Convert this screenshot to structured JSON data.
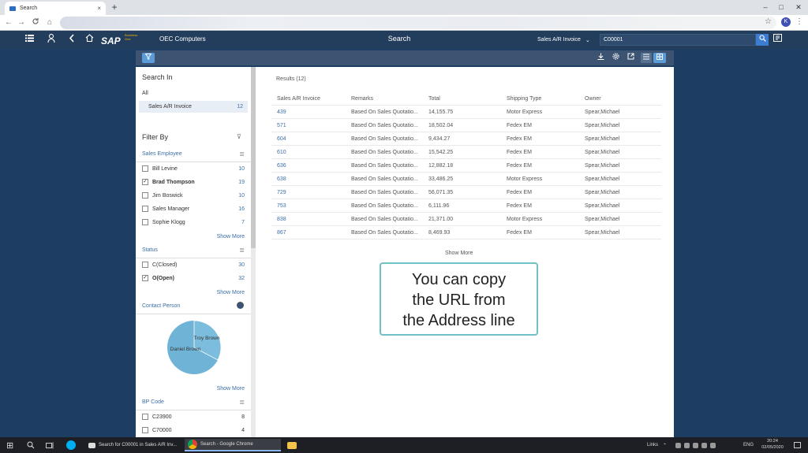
{
  "browser": {
    "tab_title": "Search",
    "tab_close": "×",
    "new_tab": "+",
    "window_controls": [
      "–",
      "□",
      "✕"
    ],
    "nav": [
      "←",
      "→",
      "C",
      "⌂"
    ],
    "bookmark": "☆",
    "profile_initial": "K",
    "menu": "⋮"
  },
  "shell": {
    "logo_text": "SAP",
    "logo_sub": "Business One",
    "company": "OEC Computers",
    "title": "Search",
    "scope_select": "Sales A/R Invoice",
    "search_value": "C00001",
    "icons": [
      "menu-icon",
      "user-icon",
      "back-icon",
      "home-icon",
      "search-icon",
      "notifications-icon"
    ]
  },
  "left_panel": {
    "search_in_title": "Search In",
    "all_label": "All",
    "selected_item": {
      "label": "Sales A/R Invoice",
      "count": "12"
    },
    "filter_by_title": "Filter By",
    "sales_employee": {
      "title": "Sales Employee",
      "items": [
        {
          "label": "Bill Levine",
          "count": "10",
          "checked": false
        },
        {
          "label": "Brad Thompson",
          "count": "19",
          "checked": true
        },
        {
          "label": "Jim Boswick",
          "count": "10",
          "checked": false
        },
        {
          "label": "Sales Manager",
          "count": "16",
          "checked": false
        },
        {
          "label": "Sophie Klogg",
          "count": "7",
          "checked": false
        }
      ],
      "show_more": "Show More"
    },
    "status": {
      "title": "Status",
      "items": [
        {
          "label": "C(Closed)",
          "count": "30",
          "checked": false
        },
        {
          "label": "O(Open)",
          "count": "32",
          "checked": true
        }
      ],
      "show_more": "Show More"
    },
    "contact_person": {
      "title": "Contact Person",
      "pie_labels": [
        "Troy Brown",
        "Daniel Brown"
      ],
      "show_more": "Show More"
    },
    "bp_code": {
      "title": "BP Code",
      "items": [
        {
          "label": "C23900",
          "count": "8",
          "checked": false
        },
        {
          "label": "C70000",
          "count": "4",
          "checked": false
        }
      ]
    }
  },
  "main": {
    "results_label": "Results (12)",
    "columns": [
      "Sales A/R Invoice",
      "Remarks",
      "Total",
      "Shipping Type",
      "Owner"
    ],
    "rows": [
      [
        "439",
        "Based On Sales Quotatio...",
        "14,155.75",
        "Motor Express",
        "Spear,Michael"
      ],
      [
        "571",
        "Based On Sales Quotatio...",
        "18,502.04",
        "Fedex EM",
        "Spear,Michael"
      ],
      [
        "604",
        "Based On Sales Quotatio...",
        "9,434.27",
        "Fedex EM",
        "Spear,Michael"
      ],
      [
        "610",
        "Based On Sales Quotatio...",
        "15,542.25",
        "Fedex EM",
        "Spear,Michael"
      ],
      [
        "636",
        "Based On Sales Quotatio...",
        "12,882.18",
        "Fedex EM",
        "Spear,Michael"
      ],
      [
        "638",
        "Based On Sales Quotatio...",
        "33,486.25",
        "Motor Express",
        "Spear,Michael"
      ],
      [
        "729",
        "Based On Sales Quotatio...",
        "56,071.35",
        "Fedex EM",
        "Spear,Michael"
      ],
      [
        "753",
        "Based On Sales Quotatio...",
        "6,111.96",
        "Fedex EM",
        "Spear,Michael"
      ],
      [
        "838",
        "Based On Sales Quotatio...",
        "21,371.00",
        "Motor Express",
        "Spear,Michael"
      ],
      [
        "867",
        "Based On Sales Quotatio...",
        "8,469.93",
        "Fedex EM",
        "Spear,Michael"
      ]
    ],
    "show_more": "Show More",
    "callout_lines": [
      "You can copy",
      "the URL from",
      "the Address line"
    ]
  },
  "taskbar": {
    "start": "⊞",
    "apps": [
      {
        "label": "Search for C00001 in Sales A/R Inv...",
        "active": false
      },
      {
        "label": "Search - Google Chrome",
        "active": true
      }
    ],
    "links_label": "Links",
    "lang": "ENG",
    "time": "20:24",
    "date": "02/05/2020"
  },
  "colors": {
    "shell_bg": "#233d5c",
    "accent": "#5b9bd8",
    "link": "#3b6fa8",
    "callout_border": "#6fc1c6",
    "pie_fill": "#6fb3d6"
  }
}
